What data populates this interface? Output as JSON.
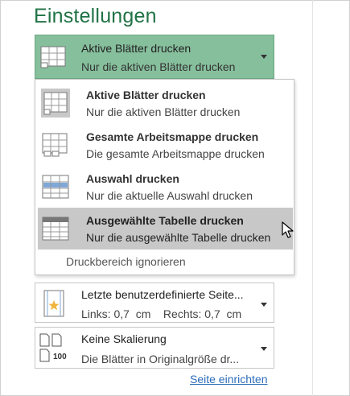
{
  "settings_title": "Einstellungen",
  "print_what": {
    "selected_title": "Aktive Blätter drucken",
    "selected_desc": "Nur die aktiven Blätter drucken",
    "options": [
      {
        "title": "Aktive Blätter drucken",
        "desc": "Nur die aktiven Blätter drucken",
        "icon": "active-sheets-icon"
      },
      {
        "title": "Gesamte Arbeitsmappe drucken",
        "desc": "Die gesamte Arbeitsmappe drucken",
        "icon": "workbook-icon"
      },
      {
        "title": "Auswahl drucken",
        "desc": "Nur die aktuelle Auswahl drucken",
        "icon": "selection-icon"
      },
      {
        "title": "Ausgewählte Tabelle drucken",
        "desc": "Nur die ausgewählte Tabelle drucken",
        "icon": "table-icon"
      }
    ],
    "ignore_print_area": "Druckbereich ignorieren"
  },
  "margins": {
    "title": "Letzte benutzerdefinierte Seite...",
    "desc": "Links: 0,7  cm    Rechts: 0,7  cm"
  },
  "scaling": {
    "title": "Keine Skalierung",
    "desc": "Die Blätter in Originalgröße dr...",
    "icon_label": "100"
  },
  "page_setup_link": "Seite einrichten",
  "colors": {
    "accent_green": "#217346",
    "selected_bg": "#86bf9c",
    "highlight_bg": "#c8c8c8",
    "link": "#2b6cb8"
  }
}
